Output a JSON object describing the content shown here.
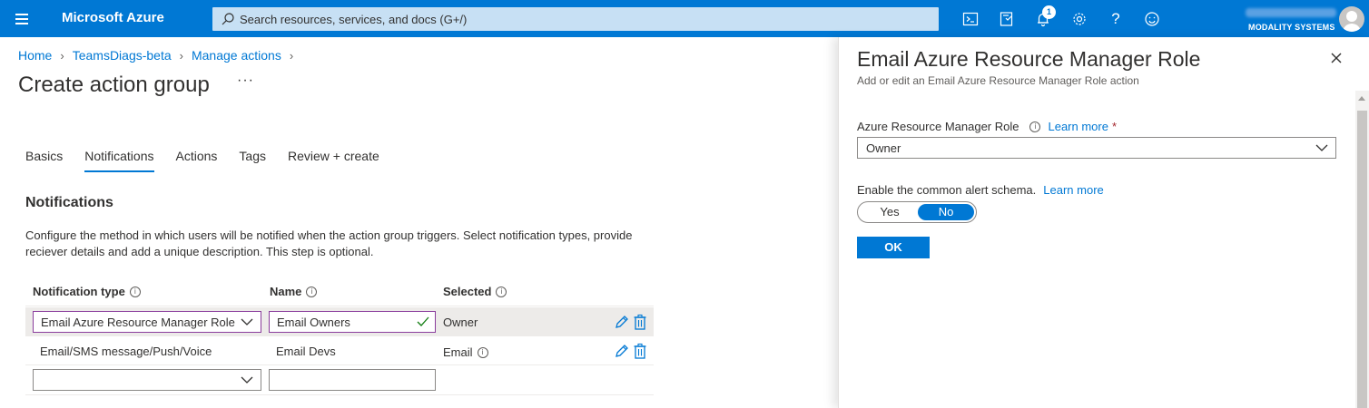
{
  "topbar": {
    "brand": "Microsoft Azure",
    "search_placeholder": "Search resources, services, and docs (G+/)",
    "notification_count": "1",
    "directory": "MODALITY SYSTEMS",
    "icons": [
      "cloud-shell-icon",
      "directory-filter-icon",
      "bell-icon",
      "gear-icon",
      "help-icon",
      "feedback-icon"
    ],
    "accent": "#0078d4"
  },
  "breadcrumb": [
    "Home",
    "TeamsDiags-beta",
    "Manage actions"
  ],
  "page": {
    "title": "Create action group",
    "more": "···"
  },
  "tabs": [
    {
      "label": "Basics",
      "active": false
    },
    {
      "label": "Notifications",
      "active": true
    },
    {
      "label": "Actions",
      "active": false
    },
    {
      "label": "Tags",
      "active": false
    },
    {
      "label": "Review + create",
      "active": false
    }
  ],
  "notifications": {
    "title": "Notifications",
    "description": "Configure the method in which users will be notified when the action group triggers. Select notification types, provide reciever details and add a unique description. This step is optional.",
    "columns": {
      "type": "Notification type",
      "name": "Name",
      "selected": "Selected"
    },
    "rows": [
      {
        "type": "Email Azure Resource Manager Role",
        "name": "Email Owners",
        "selected": "Owner"
      },
      {
        "type": "Email/SMS message/Push/Voice",
        "name": "Email Devs",
        "selected": "Email"
      },
      {
        "type": "",
        "name": "",
        "selected": ""
      }
    ]
  },
  "blade": {
    "title": "Email Azure Resource Manager Role",
    "subtitle": "Add or edit an Email Azure Resource Manager Role action",
    "role_label": "Azure Resource Manager Role",
    "role_link": "Learn more",
    "required": "*",
    "role_value": "Owner",
    "schema_label": "Enable the common alert schema.",
    "schema_link": "Learn more",
    "toggle_yes": "Yes",
    "toggle_no": "No",
    "toggle_value": "No",
    "ok_label": "OK"
  }
}
